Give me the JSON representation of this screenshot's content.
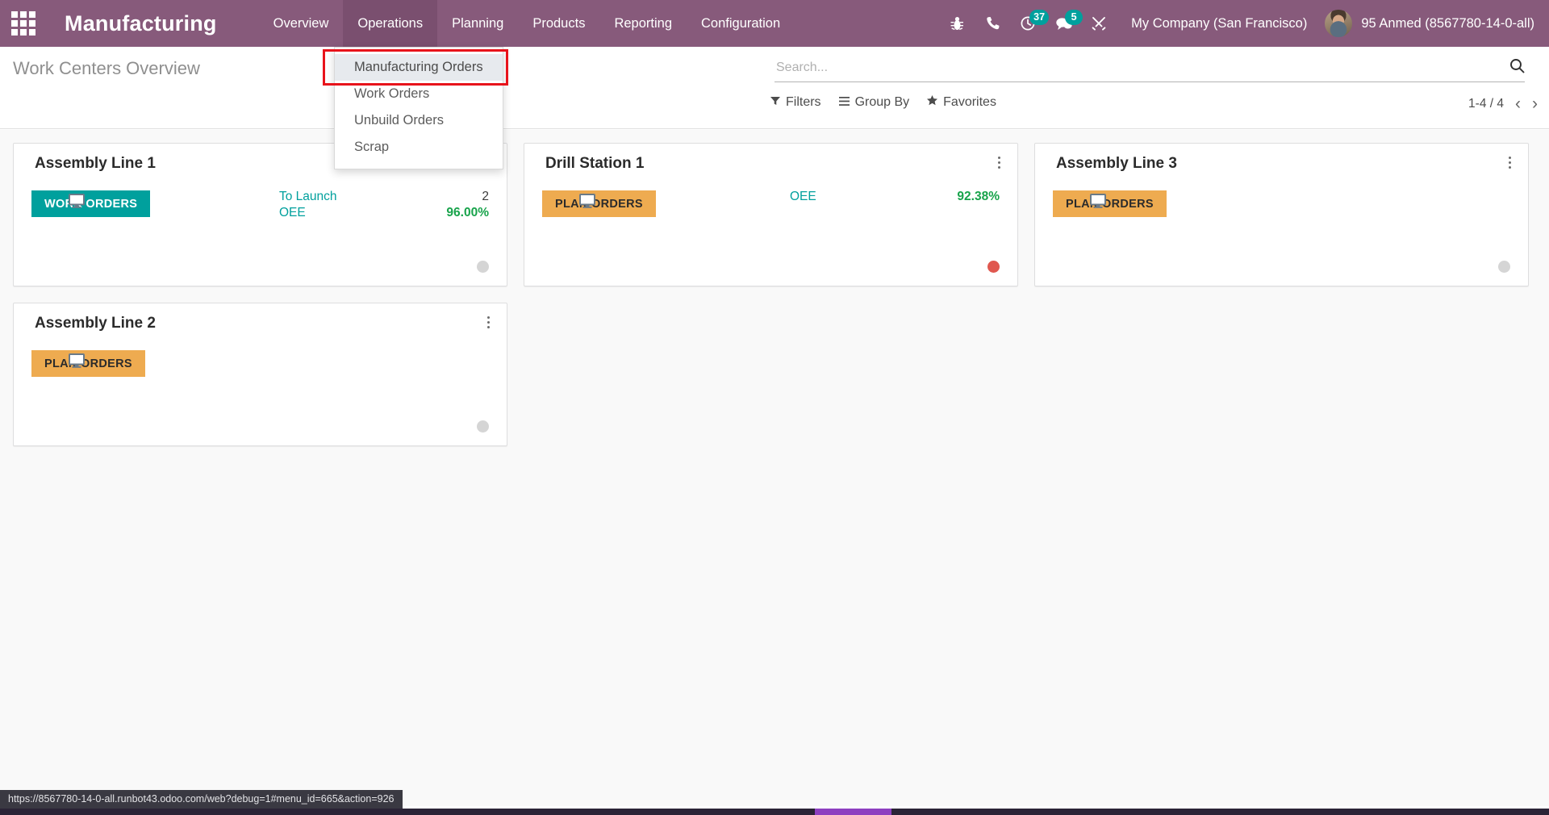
{
  "navbar": {
    "apps_icon": "apps-grid-icon",
    "brand": "Manufacturing",
    "menu_items": [
      {
        "label": "Overview",
        "active": false
      },
      {
        "label": "Operations",
        "active": true
      },
      {
        "label": "Planning",
        "active": false
      },
      {
        "label": "Products",
        "active": false
      },
      {
        "label": "Reporting",
        "active": false
      },
      {
        "label": "Configuration",
        "active": false
      }
    ],
    "icons": [
      {
        "name": "bug-icon",
        "badge": null
      },
      {
        "name": "phone-icon",
        "badge": null
      },
      {
        "name": "activity-clock-icon",
        "badge": "37"
      },
      {
        "name": "messages-icon",
        "badge": "5"
      },
      {
        "name": "tools-icon",
        "badge": null
      }
    ],
    "company": "My Company (San Francisco)",
    "user": "95 Anmed (8567780-14-0-all)",
    "accent": "#875a7b",
    "badge_color": "#00a09d"
  },
  "dropdown": {
    "items": [
      {
        "label": "Manufacturing Orders",
        "hovered": true
      },
      {
        "label": "Work Orders",
        "hovered": false
      },
      {
        "label": "Unbuild Orders",
        "hovered": false
      },
      {
        "label": "Scrap",
        "hovered": false
      }
    ],
    "highlight_color": "#e8131b"
  },
  "control_panel": {
    "breadcrumb": "Work Centers Overview",
    "search_placeholder": "Search...",
    "search_value": "",
    "search_icon": "magnifier-icon",
    "filters_label": "Filters",
    "group_by_label": "Group By",
    "favorites_label": "Favorites",
    "pager": "1-4 / 4",
    "pager_prev": "‹",
    "pager_next": "›"
  },
  "kanban": {
    "cards": [
      {
        "title": "Assembly Line 1",
        "button_label": "WORK ORDERS",
        "button_style": "teal",
        "stats": [
          {
            "label": "To Launch",
            "value": "2",
            "value_style": "plain"
          },
          {
            "label": "OEE",
            "value": "96.00%",
            "value_style": "green"
          }
        ],
        "status_dot": "grey"
      },
      {
        "title": "Drill Station 1",
        "button_label": "PLAN ORDERS",
        "button_style": "orange",
        "stats": [
          {
            "label": "OEE",
            "value": "92.38%",
            "value_style": "green"
          }
        ],
        "status_dot": "red"
      },
      {
        "title": "Assembly Line 3",
        "button_label": "PLAN ORDERS",
        "button_style": "orange",
        "stats": [],
        "status_dot": "grey"
      },
      {
        "title": "Assembly Line 2",
        "button_label": "PLAN ORDERS",
        "button_style": "orange",
        "stats": [],
        "status_dot": "grey"
      }
    ]
  },
  "status_bar": {
    "url": "https://8567780-14-0-all.runbot43.odoo.com/web?debug=1#menu_id=665&action=926"
  }
}
